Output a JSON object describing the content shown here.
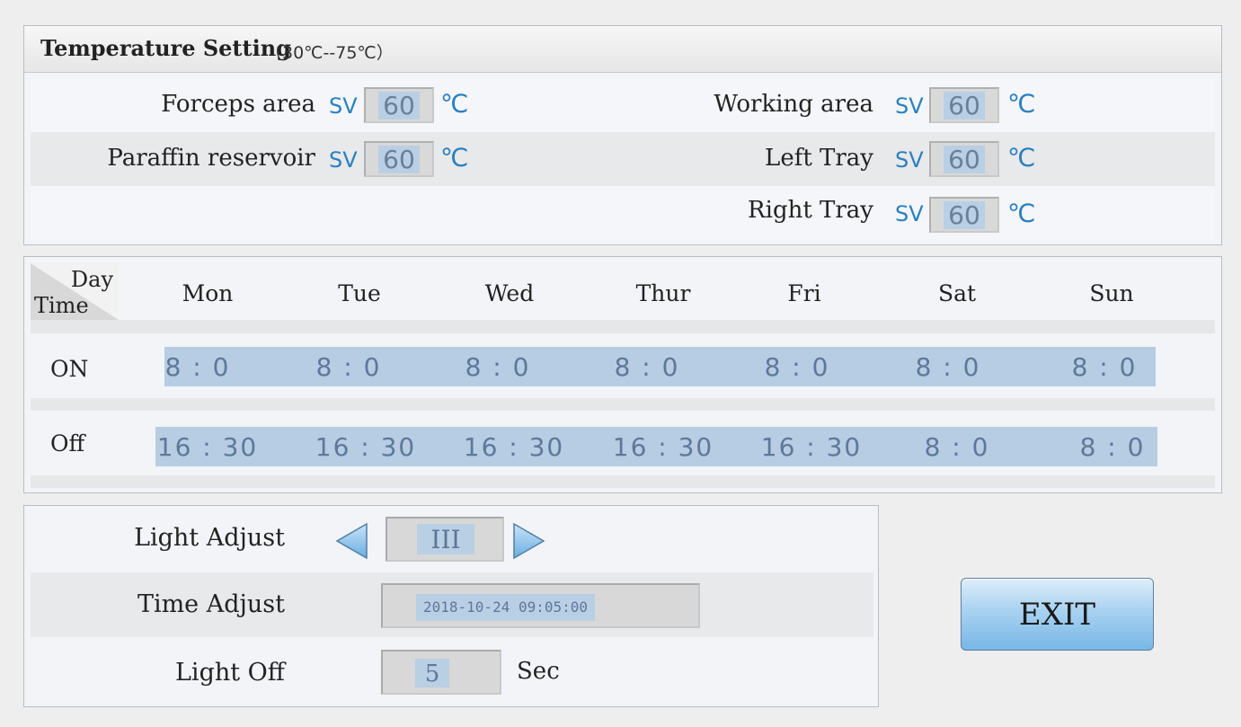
{
  "temperature": {
    "title": "Temperature Setting",
    "range": "（30℃--75℃）",
    "sv_label": "SV",
    "unit": "℃",
    "fields": [
      {
        "label": "Forceps area",
        "value": "60"
      },
      {
        "label": "Working area",
        "value": "60"
      },
      {
        "label": "Paraffin reservoir",
        "value": "60"
      },
      {
        "label": "Left Tray",
        "value": "60"
      },
      {
        "label": "Right Tray",
        "value": "60"
      }
    ]
  },
  "schedule": {
    "corner_day": "Day",
    "corner_time": "Time",
    "days": [
      "Mon",
      "Tue",
      "Wed",
      "Thur",
      "Fri",
      "Sat",
      "Sun"
    ],
    "on_label": "ON",
    "off_label": "Off",
    "on_times": [
      "8 : 0",
      "8 : 0",
      "8 : 0",
      "8 : 0",
      "8 : 0",
      "8 : 0",
      "8 : 0"
    ],
    "off_times": [
      "16 : 30",
      "16 : 30",
      "16 : 30",
      "16 : 30",
      "16 : 30",
      "8 : 0",
      "8 : 0"
    ]
  },
  "light": {
    "adjust_label": "Light Adjust",
    "level": "III",
    "time_label": "Time Adjust",
    "datetime": "2018-10-24 09:05:00",
    "off_label": "Light Off",
    "off_value": "5",
    "off_unit": "Sec"
  },
  "exit_label": "EXIT",
  "colors": {
    "accent": "#2a80bf",
    "value_bg": "#b9cfe4",
    "panel_bg": "#f2f4f8"
  }
}
